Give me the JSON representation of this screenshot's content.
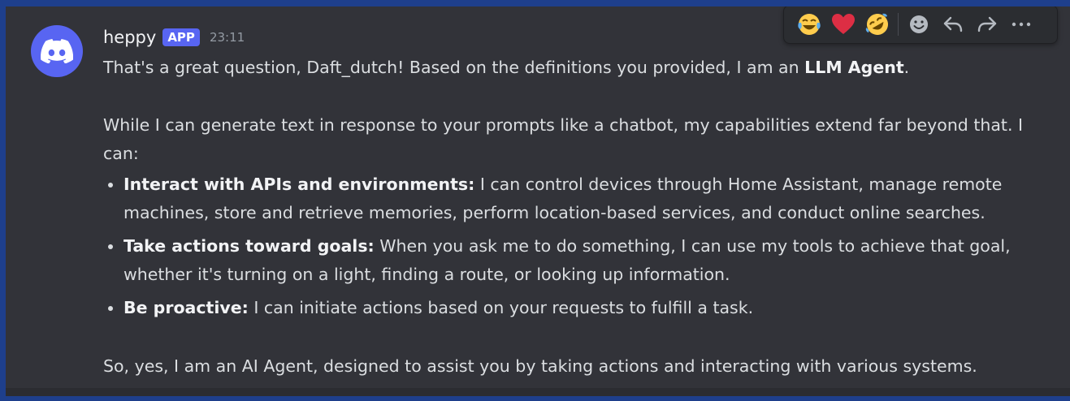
{
  "message": {
    "username": "heppy",
    "badge": "APP",
    "timestamp": "23:11",
    "line1_prefix": "That's a great question, Daft_dutch! Based on the definitions you provided, I am an ",
    "line1_bold": "LLM Agent",
    "line1_suffix": ".",
    "paragraph2": "While I can generate text in response to your prompts like a chatbot, my capabilities extend far beyond that. I can:",
    "bullets": [
      {
        "title": "Interact with APIs and environments:",
        "text": " I can control devices through Home Assistant, manage remote machines, store and retrieve memories, perform location-based services, and conduct online searches."
      },
      {
        "title": "Take actions toward goals:",
        "text": " When you ask me to do something, I can use my tools to achieve that goal, whether it's turning on a light, finding a route, or looking up information."
      },
      {
        "title": "Be proactive:",
        "text": " I can initiate actions based on your requests to fulfill a task."
      }
    ],
    "closing": "So, yes, I am an AI Agent, designed to assist you by taking actions and interacting with various systems."
  },
  "toolbar": {
    "reactions": [
      {
        "icon": "laughing-tears-emoji-icon",
        "glyph": "😂"
      },
      {
        "icon": "red-heart-emoji-icon",
        "glyph": "❤️"
      },
      {
        "icon": "rolling-laughing-emoji-icon",
        "glyph": "🤣"
      }
    ],
    "actions": [
      "add-reaction-icon",
      "reply-icon",
      "forward-icon",
      "more-options-icon"
    ]
  },
  "colors": {
    "background": "#323339",
    "brand": "#5865f2",
    "text": "#dbdee1",
    "muted": "#949ba4"
  }
}
